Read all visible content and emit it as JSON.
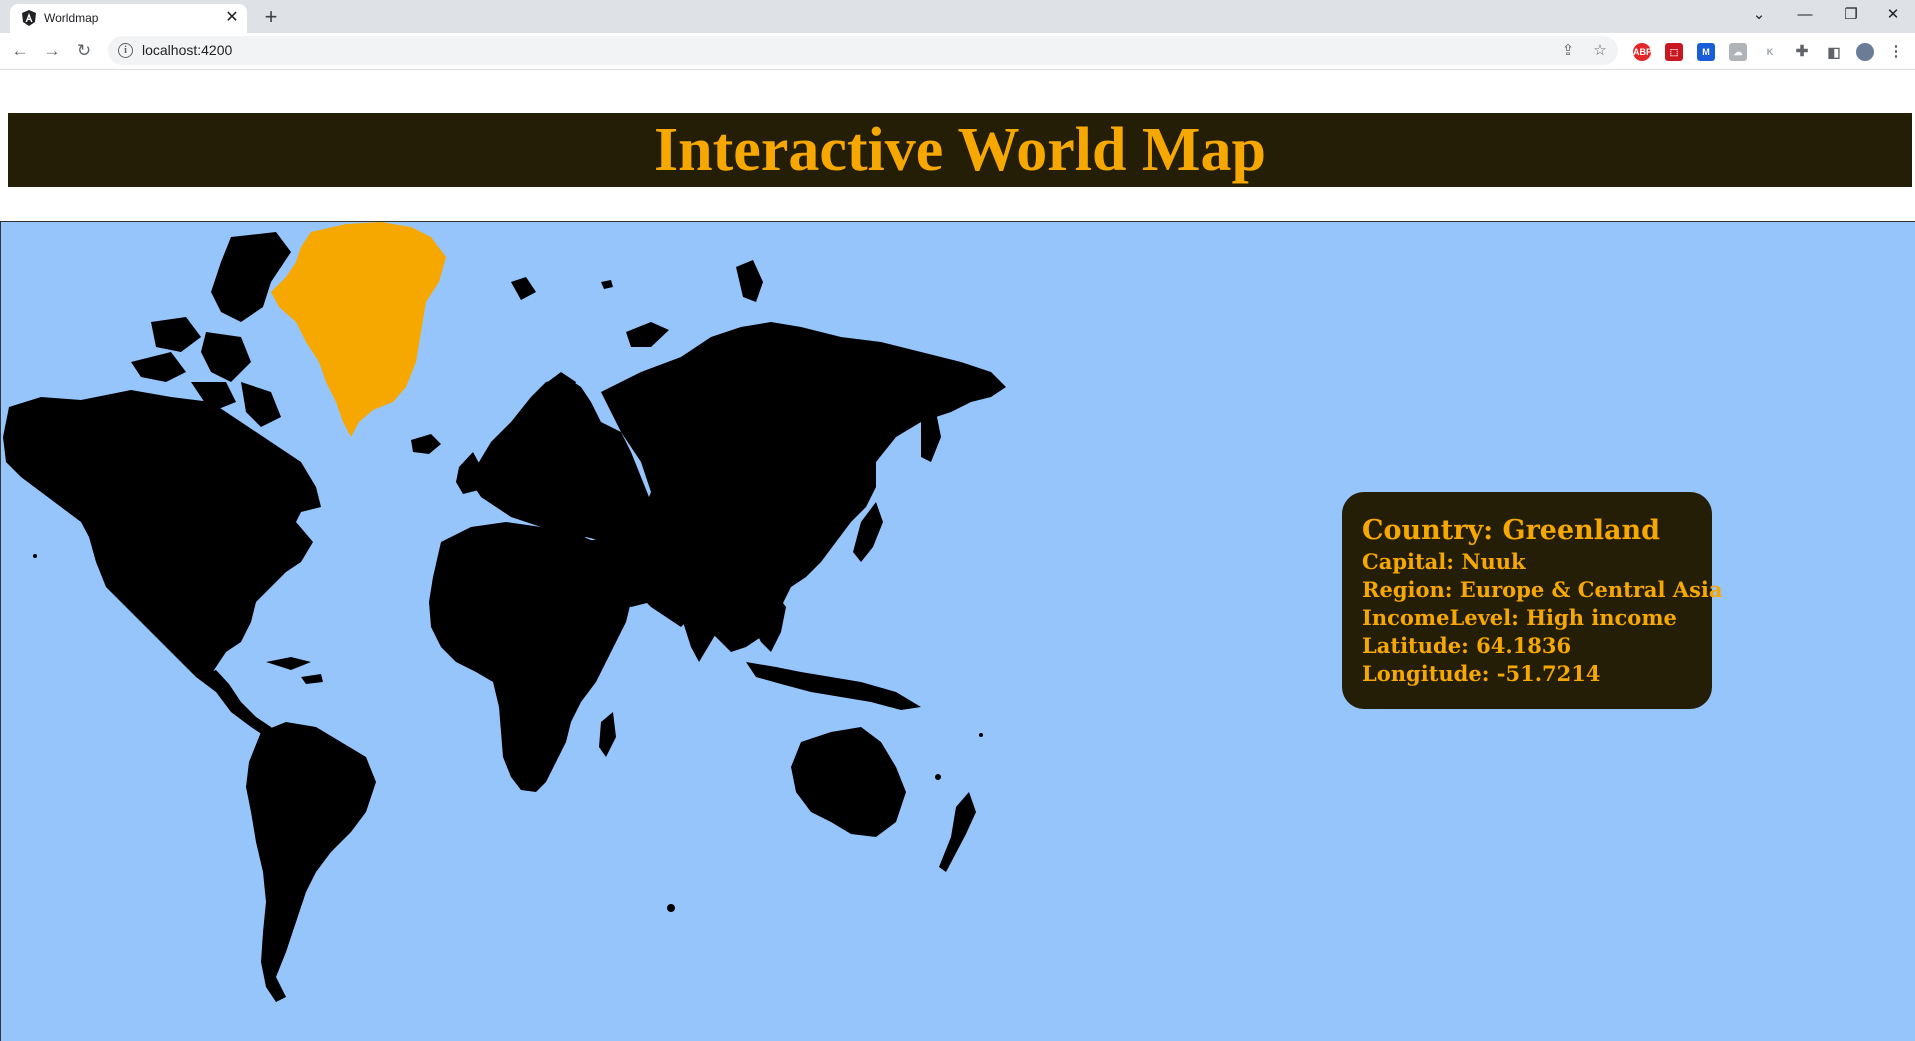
{
  "browser": {
    "tab_title": "Worldmap",
    "url": "localhost:4200",
    "extension_badge": "ABP"
  },
  "page": {
    "title": "Interactive World Map"
  },
  "map": {
    "selected_country": "Greenland",
    "colors": {
      "ocean": "#96c5fb",
      "land": "#000000",
      "selected": "#f6a800",
      "header_bg": "#241e07",
      "accent": "#f6a800"
    }
  },
  "info_panel": {
    "country": "Country: Greenland",
    "capital": "Capital: Nuuk",
    "region": "Region: Europe & Central Asia",
    "income": "IncomeLevel: High income",
    "latitude": "Latitude: 64.1836",
    "longitude": "Longitude: -51.7214"
  }
}
